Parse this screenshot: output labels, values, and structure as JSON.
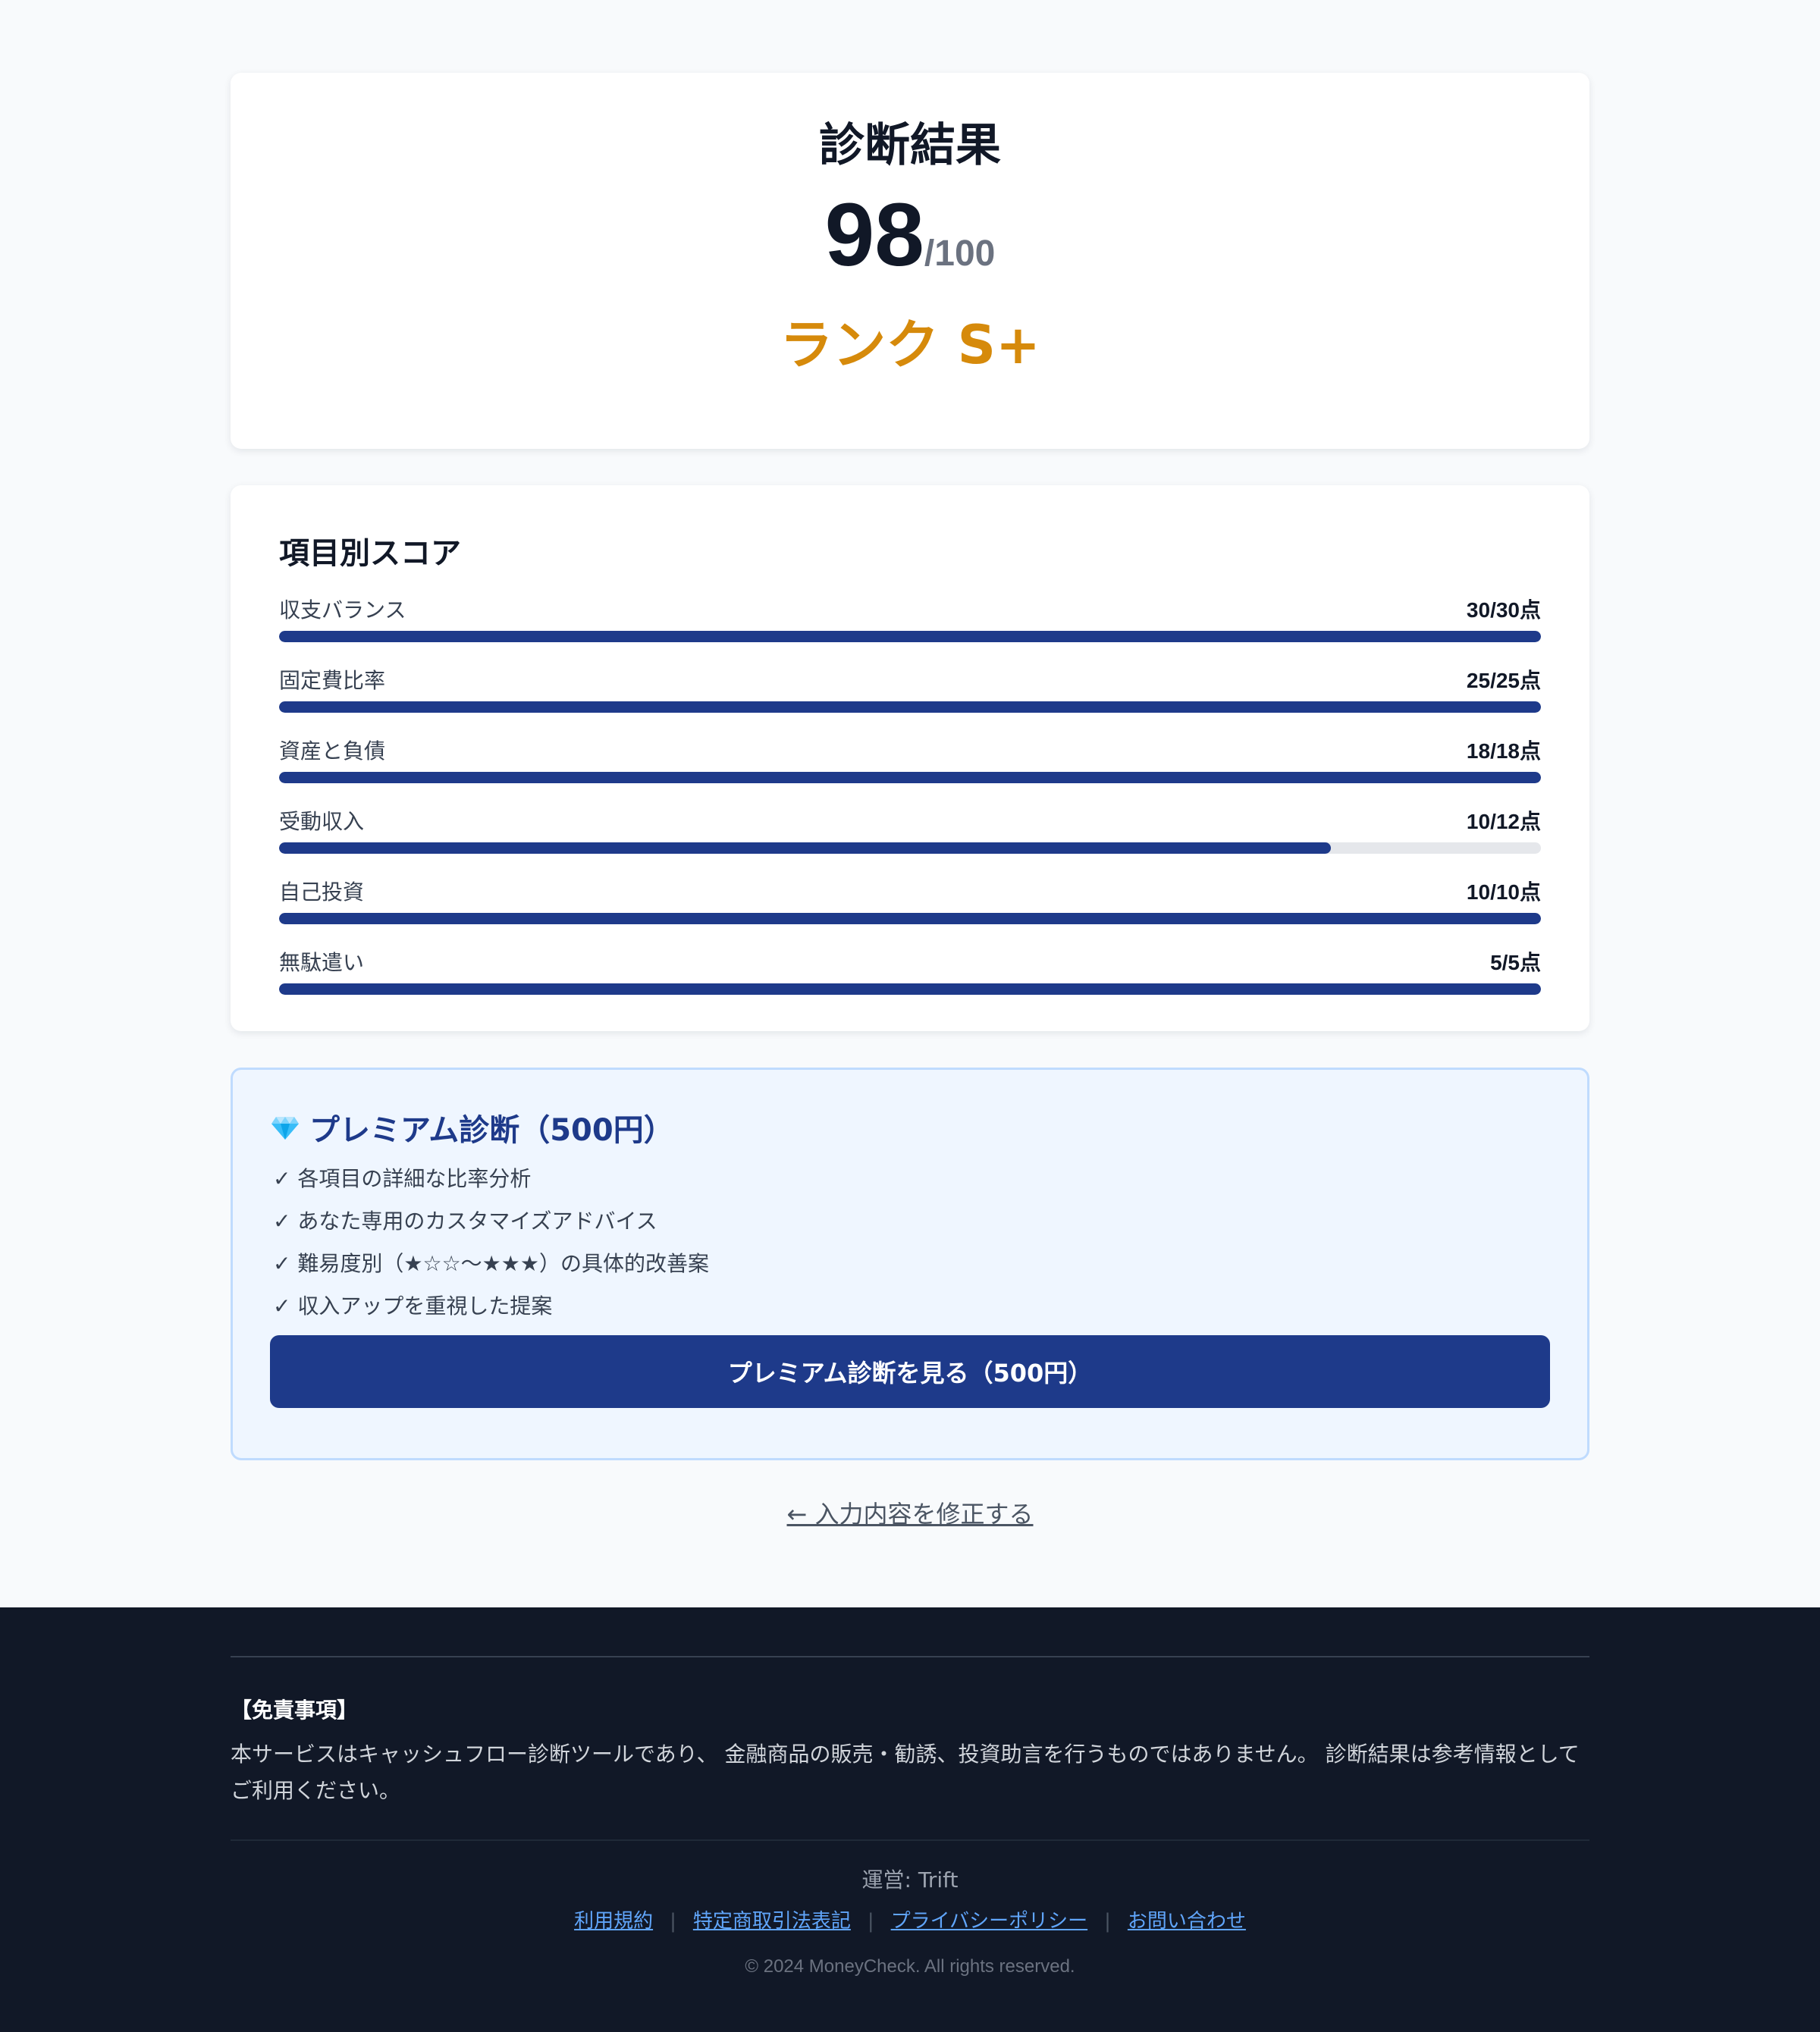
{
  "result": {
    "title": "診断結果",
    "score": "98",
    "score_max": "/100",
    "rank": "ランク S+",
    "rank_color": "#d68a0b"
  },
  "scores": {
    "title": "項目別スコア",
    "bar_color": "#1e3a8a",
    "items": [
      {
        "label": "収支バランス",
        "value": "30/30点",
        "score": 30,
        "max": 30
      },
      {
        "label": "固定費比率",
        "value": "25/25点",
        "score": 25,
        "max": 25
      },
      {
        "label": "資産と負債",
        "value": "18/18点",
        "score": 18,
        "max": 18
      },
      {
        "label": "受動収入",
        "value": "10/12点",
        "score": 10,
        "max": 12
      },
      {
        "label": "自己投資",
        "value": "10/10点",
        "score": 10,
        "max": 10
      },
      {
        "label": "無駄遣い",
        "value": "5/5点",
        "score": 5,
        "max": 5
      }
    ]
  },
  "premium": {
    "icon": "gem-icon",
    "title": "プレミアム診断（500円）",
    "features": [
      "✓ 各項目の詳細な比率分析",
      "✓ あなた専用のカスタマイズアドバイス",
      "✓ 難易度別（★☆☆〜★★★）の具体的改善案",
      "✓ 収入アップを重視した提案"
    ],
    "button_label": "プレミアム診断を見る（500円）"
  },
  "back_link": "← 入力内容を修正する",
  "footer": {
    "disclaimer_title": "【免責事項】",
    "disclaimer_text": "本サービスはキャッシュフロー診断ツールであり、 金融商品の販売・勧誘、投資助言を行うものではありません。 診断結果は参考情報としてご利用ください。",
    "operator": "運営: Trift",
    "links": [
      "利用規約",
      "特定商取引法表記",
      "プライバシーポリシー",
      "お問い合わせ"
    ],
    "separator": "|",
    "copyright": "© 2024 MoneyCheck. All rights reserved."
  }
}
